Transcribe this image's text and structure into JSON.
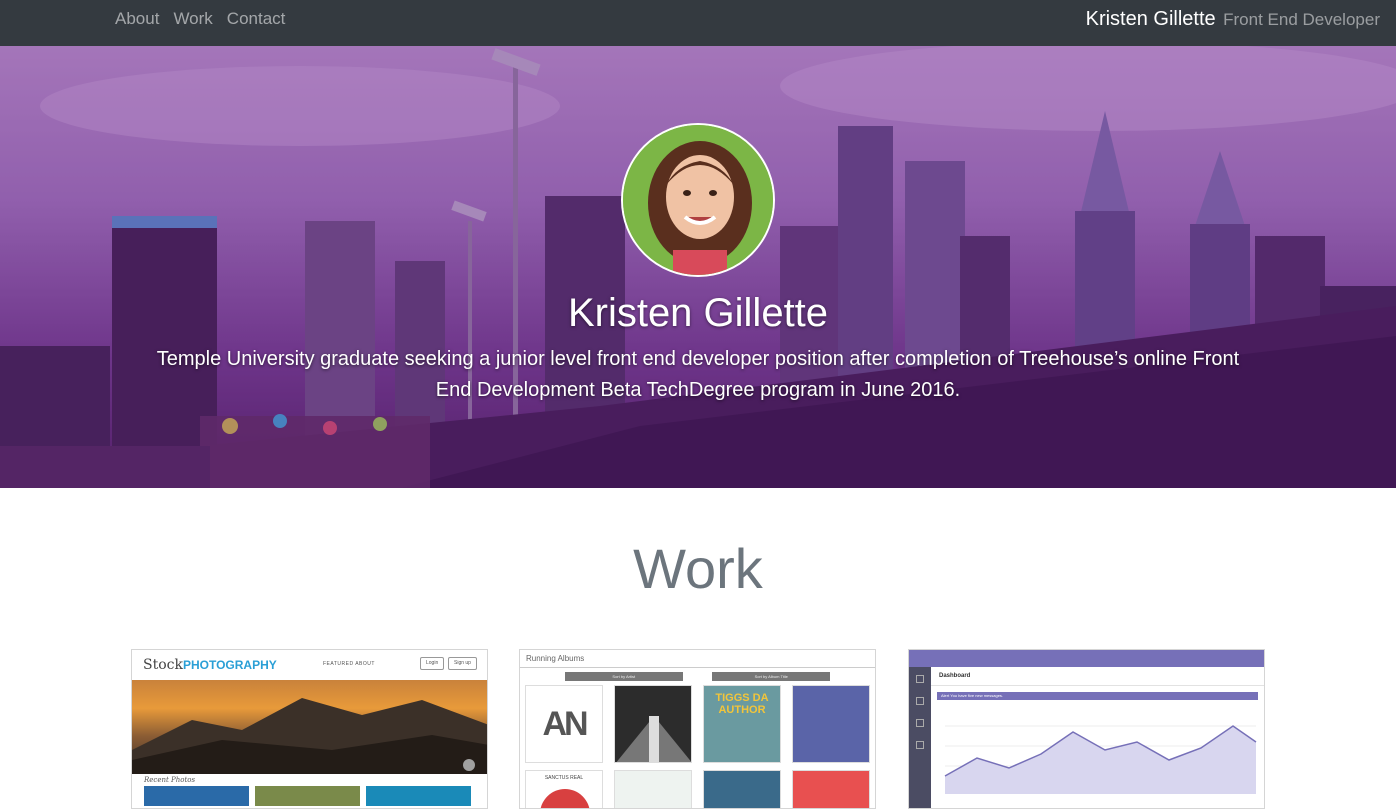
{
  "nav": {
    "links": [
      "About",
      "Work",
      "Contact"
    ],
    "brand_name": "Kristen Gillette",
    "brand_role": "Front End Developer"
  },
  "hero": {
    "name": "Kristen Gillette",
    "bio": "Temple University graduate seeking a junior level front end developer position after completion of Treehouse’s online Front End Development Beta TechDegree program in June 2016."
  },
  "work": {
    "title": "Work",
    "cards": [
      {
        "logo_main": "Stock",
        "logo_accent": "PHOTOGRAPHY",
        "nav": "FEATURED   ABOUT",
        "login": "Login",
        "signup": "Sign up",
        "section": "Recent Photos"
      },
      {
        "heading": "Running Albums",
        "sort_artist": "Sort by Artist",
        "sort_title": "Sort by Album Title",
        "album_texts": [
          "AN",
          "",
          "TIGGS DA AUTHOR",
          "",
          "SANCTUS REAL",
          "",
          "",
          ""
        ]
      },
      {
        "title": "Dashboard",
        "alert": "Alert You have five new messages."
      }
    ]
  },
  "colors": {
    "navbar": "#343a40",
    "hero_overlay": "#7a3c9a",
    "work_title": "#6c757d",
    "accent": "#2a9fd6",
    "dashboard": "#7670b8"
  }
}
